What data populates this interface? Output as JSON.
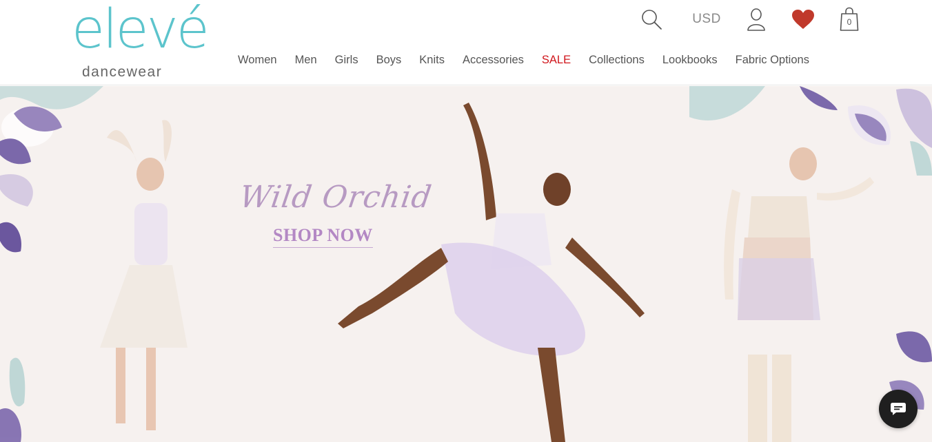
{
  "brand": {
    "logo_main": "elevé",
    "logo_sub": "dancewear",
    "accent": "#5cc4cc"
  },
  "header": {
    "currency": "USD",
    "cart_count": "0",
    "icons": {
      "search": "search-icon",
      "account": "user-icon",
      "wishlist": "heart-icon",
      "cart": "shopping-bag-icon"
    },
    "wishlist_color": "#c0392b"
  },
  "nav": {
    "items": [
      {
        "label": "Women"
      },
      {
        "label": "Men"
      },
      {
        "label": "Girls"
      },
      {
        "label": "Boys"
      },
      {
        "label": "Knits"
      },
      {
        "label": "Accessories"
      },
      {
        "label": "SALE"
      },
      {
        "label": "Collections"
      },
      {
        "label": "Lookbooks"
      },
      {
        "label": "Fabric Options"
      }
    ],
    "sale_color": "#d0151b"
  },
  "hero": {
    "title": "Wild Orchid",
    "cta": "SHOP NOW",
    "title_color": "#b79ac2",
    "cta_color": "#b388c4"
  },
  "chat": {
    "icon": "chat-bubble-icon"
  }
}
